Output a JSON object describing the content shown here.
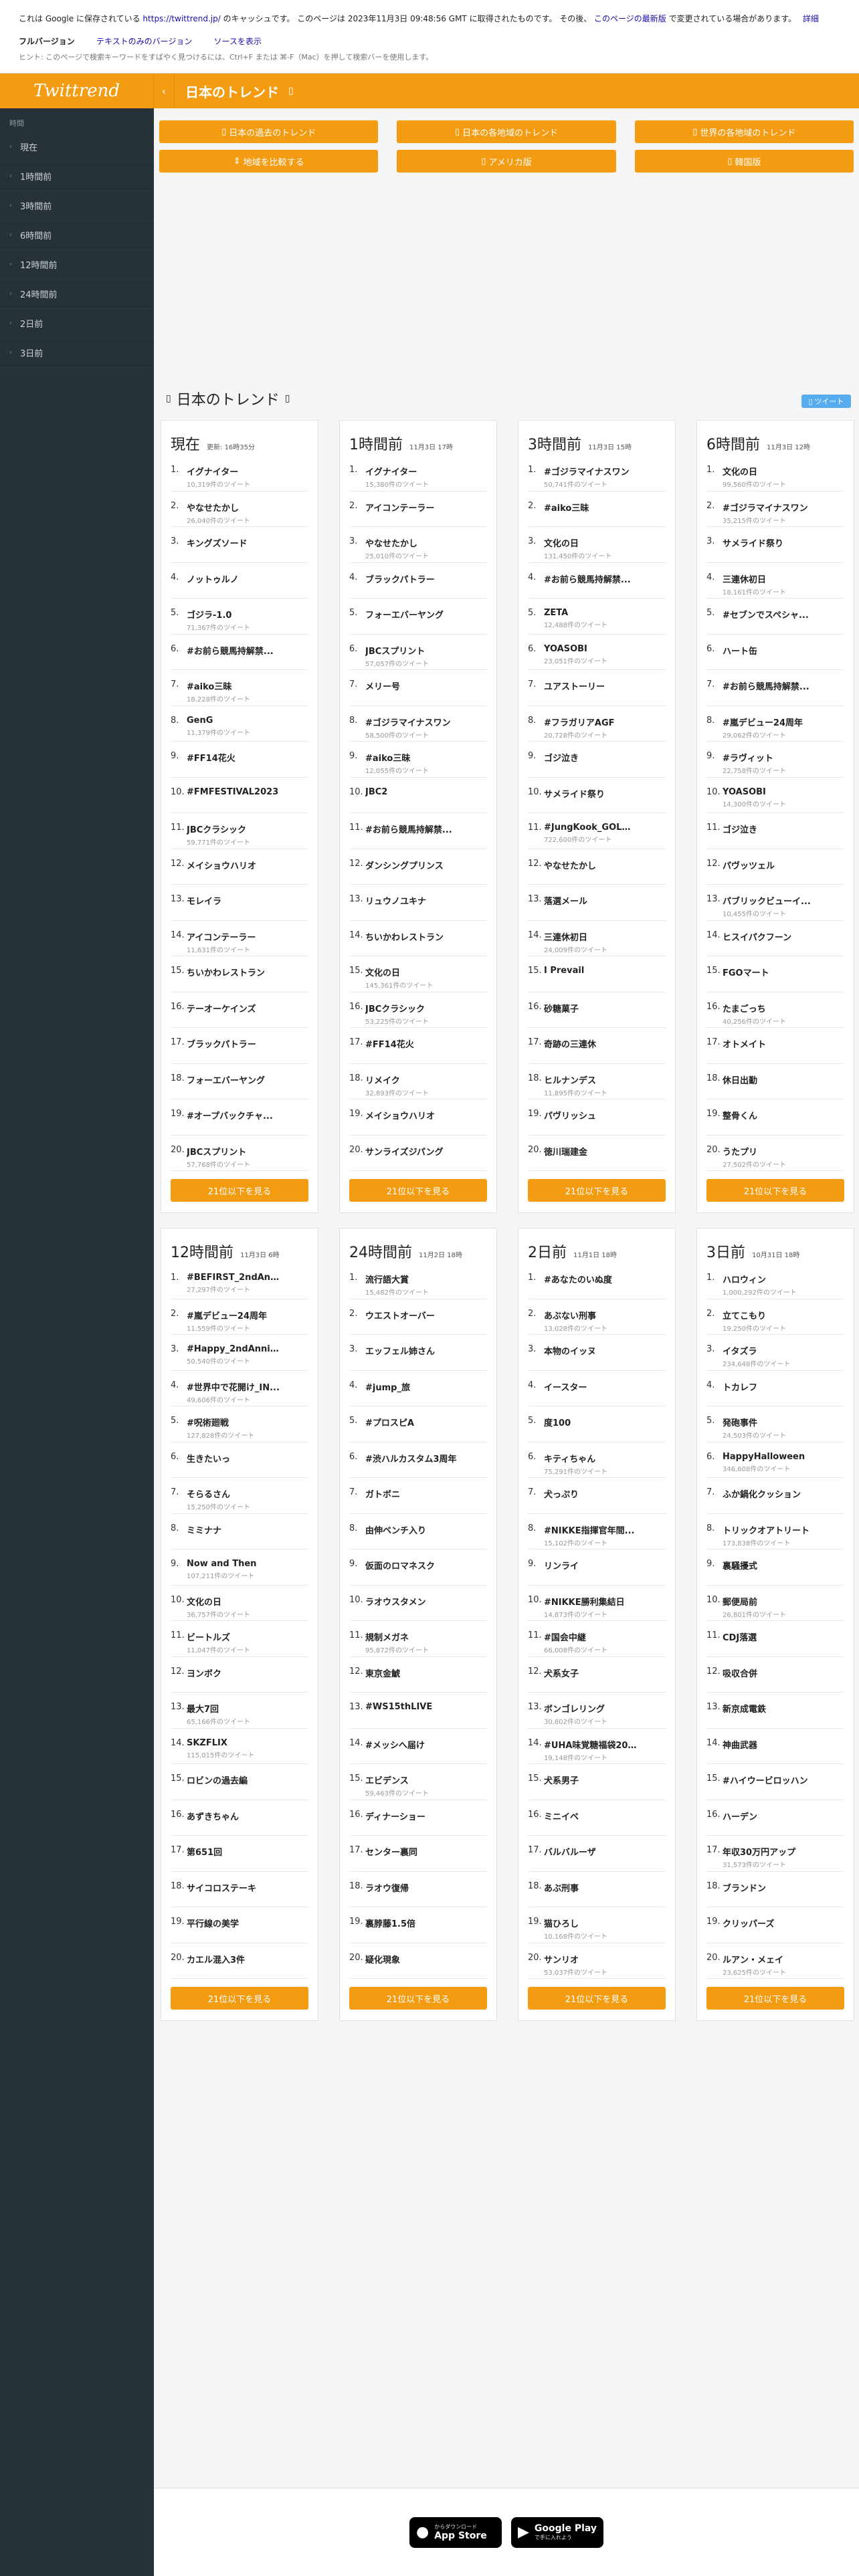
{
  "banner": {
    "text_pre": "これは Google に保存されている",
    "url": "https://twittrend.jp/",
    "text_mid": "のキャッシュです。 このページは 2023年11月3日 09:48:56 GMT に取得されたものです。 その後、",
    "latest_link": "このページの最新版",
    "text_post": "で変更されている場合があります。",
    "detail_link": "詳細",
    "full_version": "フルバージョン",
    "text_only": "テキストのみのバージョン",
    "source": "ソースを表示",
    "hint": "ヒント: このページで検索キーワードをすばやく見つけるには、Ctrl+F または ⌘-F（Mac）を押して検索バーを使用します。"
  },
  "logo": "Twittrend",
  "sidebar": {
    "label": "時間",
    "items": [
      "現在",
      "1時間前",
      "3時間前",
      "6時間前",
      "12時間前",
      "24時間前",
      "2日前",
      "3日前"
    ]
  },
  "header": {
    "title": "日本のトレンド"
  },
  "nav": [
    "日本の過去のトレンド",
    "日本の各地域のトレンド",
    "世界の各地域のトレンド",
    "地域を比較する",
    "アメリカ版",
    "韓国版"
  ],
  "section_title": "日本のトレンド",
  "tweet_button": "ツイート",
  "more_label": "21位以下を見る",
  "cards": [
    {
      "title": "現在",
      "time": "更新: 16時35分",
      "trends": [
        {
          "n": "1.",
          "name": "イグナイター",
          "cnt": "10,319件のツイート"
        },
        {
          "n": "2.",
          "name": "やなせたかし",
          "cnt": "26,040件のツイート"
        },
        {
          "n": "3.",
          "name": "キングズソード",
          "cnt": ""
        },
        {
          "n": "4.",
          "name": "ノットゥルノ",
          "cnt": ""
        },
        {
          "n": "5.",
          "name": "ゴジラ-1.0",
          "cnt": "71,367件のツイート"
        },
        {
          "n": "6.",
          "name": "#お前ら競馬持解禁...",
          "cnt": ""
        },
        {
          "n": "7.",
          "name": "#aiko三昧",
          "cnt": "18,228件のツイート"
        },
        {
          "n": "8.",
          "name": "GenG",
          "cnt": "11,379件のツイート"
        },
        {
          "n": "9.",
          "name": "#FF14花火",
          "cnt": ""
        },
        {
          "n": "10.",
          "name": "#FMFESTIVAL2023",
          "cnt": ""
        },
        {
          "n": "11.",
          "name": "JBCクラシック",
          "cnt": "59,771件のツイート"
        },
        {
          "n": "12.",
          "name": "メイショウハリオ",
          "cnt": ""
        },
        {
          "n": "13.",
          "name": "モレイラ",
          "cnt": ""
        },
        {
          "n": "14.",
          "name": "アイコンテーラー",
          "cnt": "11,631件のツイート"
        },
        {
          "n": "15.",
          "name": "ちいかわレストラン",
          "cnt": ""
        },
        {
          "n": "16.",
          "name": "テーオーケインズ",
          "cnt": ""
        },
        {
          "n": "17.",
          "name": "ブラックパトラー",
          "cnt": ""
        },
        {
          "n": "18.",
          "name": "フォーエバーヤング",
          "cnt": ""
        },
        {
          "n": "19.",
          "name": "#オープバックチャ...",
          "cnt": ""
        },
        {
          "n": "20.",
          "name": "JBCスプリント",
          "cnt": "57,768件のツイート"
        }
      ]
    },
    {
      "title": "1時間前",
      "time": "11月3日 17時",
      "trends": [
        {
          "n": "1.",
          "name": "イグナイター",
          "cnt": "15,380件のツイート"
        },
        {
          "n": "2.",
          "name": "アイコンテーラー",
          "cnt": ""
        },
        {
          "n": "3.",
          "name": "やなせたかし",
          "cnt": "25,010件のツイート"
        },
        {
          "n": "4.",
          "name": "ブラックパトラー",
          "cnt": ""
        },
        {
          "n": "5.",
          "name": "フォーエバーヤング",
          "cnt": ""
        },
        {
          "n": "6.",
          "name": "JBCスプリント",
          "cnt": "57,057件のツイート"
        },
        {
          "n": "7.",
          "name": "メリー号",
          "cnt": ""
        },
        {
          "n": "8.",
          "name": "#ゴジラマイナスワン",
          "cnt": "58,500件のツイート"
        },
        {
          "n": "9.",
          "name": "#aiko三昧",
          "cnt": "12,055件のツイート"
        },
        {
          "n": "10.",
          "name": "JBC2",
          "cnt": ""
        },
        {
          "n": "11.",
          "name": "#お前ら競馬持解禁...",
          "cnt": ""
        },
        {
          "n": "12.",
          "name": "ダンシングプリンス",
          "cnt": ""
        },
        {
          "n": "13.",
          "name": "リュウノユキナ",
          "cnt": ""
        },
        {
          "n": "14.",
          "name": "ちいかわレストラン",
          "cnt": ""
        },
        {
          "n": "15.",
          "name": "文化の日",
          "cnt": "145,361件のツイート"
        },
        {
          "n": "16.",
          "name": "JBCクラシック",
          "cnt": "53,225件のツイート"
        },
        {
          "n": "17.",
          "name": "#FF14花火",
          "cnt": ""
        },
        {
          "n": "18.",
          "name": "リメイク",
          "cnt": "32,893件のツイート"
        },
        {
          "n": "19.",
          "name": "メイショウハリオ",
          "cnt": ""
        },
        {
          "n": "20.",
          "name": "サンライズジパング",
          "cnt": ""
        }
      ]
    },
    {
      "title": "3時間前",
      "time": "11月3日 15時",
      "trends": [
        {
          "n": "1.",
          "name": "#ゴジラマイナスワン",
          "cnt": "50,741件のツイート"
        },
        {
          "n": "2.",
          "name": "#aiko三昧",
          "cnt": ""
        },
        {
          "n": "3.",
          "name": "文化の日",
          "cnt": "131,450件のツイート"
        },
        {
          "n": "4.",
          "name": "#お前ら競馬持解禁...",
          "cnt": ""
        },
        {
          "n": "5.",
          "name": "ZETA",
          "cnt": "12,488件のツイート"
        },
        {
          "n": "6.",
          "name": "YOASOBI",
          "cnt": "23,051件のツイート"
        },
        {
          "n": "7.",
          "name": "ユアストーリー",
          "cnt": ""
        },
        {
          "n": "8.",
          "name": "#フラガリアAGF",
          "cnt": "20,728件のツイート"
        },
        {
          "n": "9.",
          "name": "ゴジ泣き",
          "cnt": ""
        },
        {
          "n": "10.",
          "name": "サメライド祭り",
          "cnt": ""
        },
        {
          "n": "11.",
          "name": "#JungKook_GOLD...",
          "cnt": "722,600件のツイート"
        },
        {
          "n": "12.",
          "name": "やなせたかし",
          "cnt": ""
        },
        {
          "n": "13.",
          "name": "落選メール",
          "cnt": ""
        },
        {
          "n": "14.",
          "name": "三連休初日",
          "cnt": "24,009件のツイート"
        },
        {
          "n": "15.",
          "name": "I Prevail",
          "cnt": ""
        },
        {
          "n": "16.",
          "name": "砂糖菓子",
          "cnt": ""
        },
        {
          "n": "17.",
          "name": "奇跡の三連休",
          "cnt": ""
        },
        {
          "n": "18.",
          "name": "ヒルナンデス",
          "cnt": "11,895件のツイート"
        },
        {
          "n": "19.",
          "name": "パヴリッシュ",
          "cnt": ""
        },
        {
          "n": "20.",
          "name": "徳川瑞建金",
          "cnt": ""
        }
      ]
    },
    {
      "title": "6時間前",
      "time": "11月3日 12時",
      "trends": [
        {
          "n": "1.",
          "name": "文化の日",
          "cnt": "99,560件のツイート"
        },
        {
          "n": "2.",
          "name": "#ゴジラマイナスワン",
          "cnt": "35,215件のツイート"
        },
        {
          "n": "3.",
          "name": "サメライド祭り",
          "cnt": ""
        },
        {
          "n": "4.",
          "name": "三連休初日",
          "cnt": "18,161件のツイート"
        },
        {
          "n": "5.",
          "name": "#セブンでスペシャ...",
          "cnt": ""
        },
        {
          "n": "6.",
          "name": "ハート缶",
          "cnt": ""
        },
        {
          "n": "7.",
          "name": "#お前ら競馬持解禁...",
          "cnt": ""
        },
        {
          "n": "8.",
          "name": "#嵐デビュー24周年",
          "cnt": "29,062件のツイート"
        },
        {
          "n": "9.",
          "name": "#ラヴィット",
          "cnt": "22,758件のツイート"
        },
        {
          "n": "10.",
          "name": "YOASOBI",
          "cnt": "14,300件のツイート"
        },
        {
          "n": "11.",
          "name": "ゴジ泣き",
          "cnt": ""
        },
        {
          "n": "12.",
          "name": "パヴッツェル",
          "cnt": ""
        },
        {
          "n": "13.",
          "name": "パブリックビューイ...",
          "cnt": "10,455件のツイート"
        },
        {
          "n": "14.",
          "name": "ヒスイパクフーン",
          "cnt": ""
        },
        {
          "n": "15.",
          "name": "FGOマート",
          "cnt": ""
        },
        {
          "n": "16.",
          "name": "たまごっち",
          "cnt": "40,256件のツイート"
        },
        {
          "n": "17.",
          "name": "オトメイト",
          "cnt": ""
        },
        {
          "n": "18.",
          "name": "休日出勤",
          "cnt": ""
        },
        {
          "n": "19.",
          "name": "整骨くん",
          "cnt": ""
        },
        {
          "n": "20.",
          "name": "うたプリ",
          "cnt": "27,502件のツイート"
        }
      ]
    },
    {
      "title": "12時間前",
      "time": "11月3日 6時",
      "trends": [
        {
          "n": "1.",
          "name": "#BEFIRST_2ndAnniv",
          "cnt": "27,297件のツイート"
        },
        {
          "n": "2.",
          "name": "#嵐デビュー24周年",
          "cnt": "11,559件のツイート"
        },
        {
          "n": "3.",
          "name": "#Happy_2ndAnniv...",
          "cnt": "50,540件のツイート"
        },
        {
          "n": "4.",
          "name": "#世界中で花開け_IN...",
          "cnt": "49,606件のツイート"
        },
        {
          "n": "5.",
          "name": "#呪術廻戦",
          "cnt": "127,828件のツイート"
        },
        {
          "n": "6.",
          "name": "生きたいっ",
          "cnt": ""
        },
        {
          "n": "7.",
          "name": "そらるさん",
          "cnt": "15,250件のツイート"
        },
        {
          "n": "8.",
          "name": "ミミナナ",
          "cnt": ""
        },
        {
          "n": "9.",
          "name": "Now and Then",
          "cnt": "107,211件のツイート"
        },
        {
          "n": "10.",
          "name": "文化の日",
          "cnt": "36,757件のツイート"
        },
        {
          "n": "11.",
          "name": "ビートルズ",
          "cnt": "11,047件のツイート"
        },
        {
          "n": "12.",
          "name": "ヨンボク",
          "cnt": ""
        },
        {
          "n": "13.",
          "name": "最大7回",
          "cnt": "65,166件のツイート"
        },
        {
          "n": "14.",
          "name": "SKZFLIX",
          "cnt": "115,015件のツイート"
        },
        {
          "n": "15.",
          "name": "ロビンの過去編",
          "cnt": ""
        },
        {
          "n": "16.",
          "name": "あずきちゃん",
          "cnt": ""
        },
        {
          "n": "17.",
          "name": "第651回",
          "cnt": ""
        },
        {
          "n": "18.",
          "name": "サイコロステーキ",
          "cnt": ""
        },
        {
          "n": "19.",
          "name": "平行線の美学",
          "cnt": ""
        },
        {
          "n": "20.",
          "name": "カエル混入3件",
          "cnt": ""
        }
      ]
    },
    {
      "title": "24時間前",
      "time": "11月2日 18時",
      "trends": [
        {
          "n": "1.",
          "name": "流行語大賞",
          "cnt": "15,482件のツイート"
        },
        {
          "n": "2.",
          "name": "ウエストオーバー",
          "cnt": ""
        },
        {
          "n": "3.",
          "name": "エッフェル姉さん",
          "cnt": ""
        },
        {
          "n": "4.",
          "name": "#jump_旅",
          "cnt": ""
        },
        {
          "n": "5.",
          "name": "#プロスピA",
          "cnt": ""
        },
        {
          "n": "6.",
          "name": "#渋ハルカスタム3周年",
          "cnt": ""
        },
        {
          "n": "7.",
          "name": "ガトボニ",
          "cnt": ""
        },
        {
          "n": "8.",
          "name": "由伸ベンチ入り",
          "cnt": ""
        },
        {
          "n": "9.",
          "name": "仮面のロマネスク",
          "cnt": ""
        },
        {
          "n": "10.",
          "name": "ラオウスタメン",
          "cnt": ""
        },
        {
          "n": "11.",
          "name": "規制メガネ",
          "cnt": "95,872件のツイート"
        },
        {
          "n": "12.",
          "name": "東京金鯱",
          "cnt": ""
        },
        {
          "n": "13.",
          "name": "#WS15thLIVE",
          "cnt": ""
        },
        {
          "n": "14.",
          "name": "#メッシへ届け",
          "cnt": ""
        },
        {
          "n": "15.",
          "name": "エビデンス",
          "cnt": "59,463件のツイート"
        },
        {
          "n": "16.",
          "name": "ディナーショー",
          "cnt": ""
        },
        {
          "n": "17.",
          "name": "センター裏同",
          "cnt": ""
        },
        {
          "n": "18.",
          "name": "ラオウ復帰",
          "cnt": ""
        },
        {
          "n": "19.",
          "name": "裏脖藤1.5倍",
          "cnt": ""
        },
        {
          "n": "20.",
          "name": "疑化現象",
          "cnt": ""
        }
      ]
    },
    {
      "title": "2日前",
      "time": "11月1日 18時",
      "trends": [
        {
          "n": "1.",
          "name": "#あなたのいぬ度",
          "cnt": ""
        },
        {
          "n": "2.",
          "name": "あぶない刑事",
          "cnt": "13,028件のツイート"
        },
        {
          "n": "3.",
          "name": "本物のイッヌ",
          "cnt": ""
        },
        {
          "n": "4.",
          "name": "イースター",
          "cnt": ""
        },
        {
          "n": "5.",
          "name": "度100",
          "cnt": ""
        },
        {
          "n": "6.",
          "name": "キティちゃん",
          "cnt": "75,291件のツイート"
        },
        {
          "n": "7.",
          "name": "犬っぷり",
          "cnt": ""
        },
        {
          "n": "8.",
          "name": "#NIKKE指揮官年間...",
          "cnt": "15,102件のツイート"
        },
        {
          "n": "9.",
          "name": "リンライ",
          "cnt": ""
        },
        {
          "n": "10.",
          "name": "#NIKKE勝利集結日",
          "cnt": "14,873件のツイート"
        },
        {
          "n": "11.",
          "name": "#国会中継",
          "cnt": "66,008件のツイート"
        },
        {
          "n": "12.",
          "name": "犬系女子",
          "cnt": ""
        },
        {
          "n": "13.",
          "name": "ボンゴレリング",
          "cnt": "30,802件のツイート"
        },
        {
          "n": "14.",
          "name": "#UHA味覚糖福袋2024",
          "cnt": "19,148件のツイート"
        },
        {
          "n": "15.",
          "name": "犬系男子",
          "cnt": ""
        },
        {
          "n": "16.",
          "name": "ミニイベ",
          "cnt": ""
        },
        {
          "n": "17.",
          "name": "バルバルーザ",
          "cnt": ""
        },
        {
          "n": "18.",
          "name": "あぶ刑事",
          "cnt": ""
        },
        {
          "n": "19.",
          "name": "猫ひろし",
          "cnt": "10,168件のツイート"
        },
        {
          "n": "20.",
          "name": "サンリオ",
          "cnt": "53,037件のツイート"
        }
      ]
    },
    {
      "title": "3日前",
      "time": "10月31日 18時",
      "trends": [
        {
          "n": "1.",
          "name": "ハロウィン",
          "cnt": "1,000,292件のツイート"
        },
        {
          "n": "2.",
          "name": "立てこもり",
          "cnt": "19,250件のツイート"
        },
        {
          "n": "3.",
          "name": "イタズラ",
          "cnt": "234,648件のツイート"
        },
        {
          "n": "4.",
          "name": "トカレフ",
          "cnt": ""
        },
        {
          "n": "5.",
          "name": "発砲事件",
          "cnt": "24,503件のツイート"
        },
        {
          "n": "6.",
          "name": "HappyHalloween",
          "cnt": "346,608件のツイート"
        },
        {
          "n": "7.",
          "name": "ふか鍋化クッション",
          "cnt": ""
        },
        {
          "n": "8.",
          "name": "トリックオアトリート",
          "cnt": "173,838件のツイート"
        },
        {
          "n": "9.",
          "name": "裏騒擾式",
          "cnt": ""
        },
        {
          "n": "10.",
          "name": "郵便局前",
          "cnt": "26,801件のツイート"
        },
        {
          "n": "11.",
          "name": "CDJ落選",
          "cnt": ""
        },
        {
          "n": "12.",
          "name": "吸収合併",
          "cnt": ""
        },
        {
          "n": "13.",
          "name": "新京成電鉄",
          "cnt": ""
        },
        {
          "n": "14.",
          "name": "神曲武器",
          "cnt": ""
        },
        {
          "n": "15.",
          "name": "#ハイウービロッハン",
          "cnt": ""
        },
        {
          "n": "16.",
          "name": "ハーデン",
          "cnt": ""
        },
        {
          "n": "17.",
          "name": "年収30万円アップ",
          "cnt": "31,573件のツイート"
        },
        {
          "n": "18.",
          "name": "ブランドン",
          "cnt": ""
        },
        {
          "n": "19.",
          "name": "クリッパーズ",
          "cnt": ""
        },
        {
          "n": "20.",
          "name": "ルアン・メェイ",
          "cnt": "23,625件のツイート"
        }
      ]
    }
  ],
  "footer": {
    "appstore": "App Store",
    "appstore_sub": "からダウンロード",
    "googleplay": "Google Play",
    "googleplay_sub": "で手に入れよう"
  }
}
